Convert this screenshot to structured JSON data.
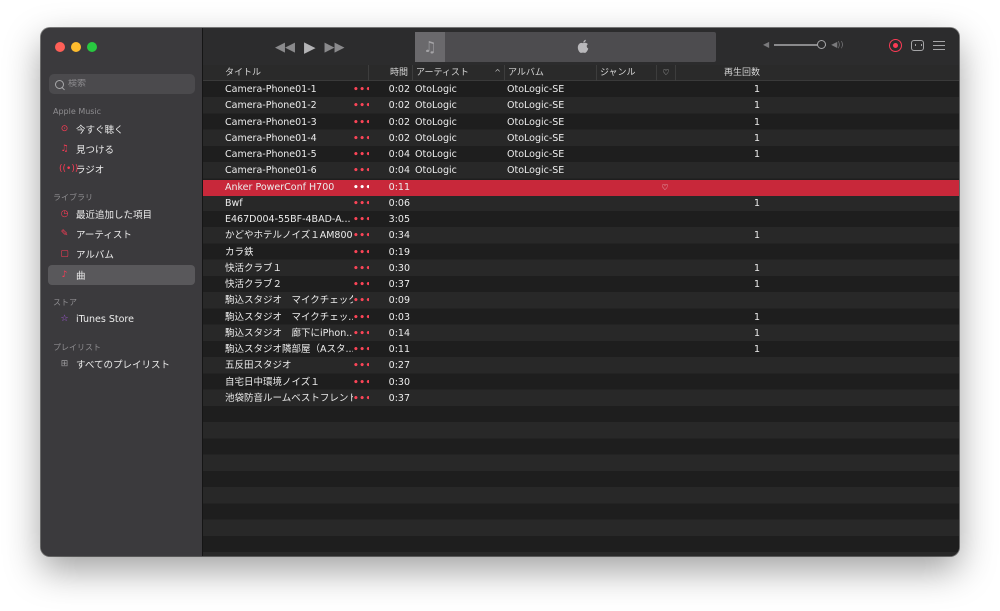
{
  "window": {
    "traffic": [
      "close",
      "minimize",
      "zoom"
    ]
  },
  "sidebar": {
    "search_placeholder": "検索",
    "sections": [
      {
        "title": "Apple Music",
        "items": [
          {
            "label": "今すぐ聴く",
            "icon": "play-circle-icon"
          },
          {
            "label": "見つける",
            "icon": "music-note-icon"
          },
          {
            "label": "ラジオ",
            "icon": "radio-icon"
          }
        ]
      },
      {
        "title": "ライブラリ",
        "items": [
          {
            "label": "最近追加した項目",
            "icon": "clock-icon"
          },
          {
            "label": "アーティスト",
            "icon": "microphone-icon"
          },
          {
            "label": "アルバム",
            "icon": "album-icon"
          },
          {
            "label": "曲",
            "icon": "music-note-icon",
            "selected": true
          }
        ]
      },
      {
        "title": "ストア",
        "items": [
          {
            "label": "iTunes Store",
            "icon": "star-icon"
          }
        ]
      },
      {
        "title": "プレイリスト",
        "items": [
          {
            "label": "すべてのプレイリスト",
            "icon": "grid-icon"
          }
        ]
      }
    ]
  },
  "toolbar": {
    "volume": 1.0
  },
  "table": {
    "columns": {
      "title": "タイトル",
      "time": "時間",
      "artist": "アーティスト",
      "sort_indicator": "^",
      "album": "アルバム",
      "genre": "ジャンル",
      "heart": "♡",
      "plays": "再生回数"
    },
    "more_glyph": "•••",
    "rows": [
      {
        "title": "Camera-Phone01-1",
        "time": "0:02",
        "artist": "OtoLogic",
        "album": "OtoLogic-SE",
        "heart": "",
        "plays": "1"
      },
      {
        "title": "Camera-Phone01-2",
        "time": "0:02",
        "artist": "OtoLogic",
        "album": "OtoLogic-SE",
        "heart": "",
        "plays": "1"
      },
      {
        "title": "Camera-Phone01-3",
        "time": "0:02",
        "artist": "OtoLogic",
        "album": "OtoLogic-SE",
        "heart": "",
        "plays": "1"
      },
      {
        "title": "Camera-Phone01-4",
        "time": "0:02",
        "artist": "OtoLogic",
        "album": "OtoLogic-SE",
        "heart": "",
        "plays": "1"
      },
      {
        "title": "Camera-Phone01-5",
        "time": "0:04",
        "artist": "OtoLogic",
        "album": "OtoLogic-SE",
        "heart": "",
        "plays": "1"
      },
      {
        "title": "Camera-Phone01-6",
        "time": "0:04",
        "artist": "OtoLogic",
        "album": "OtoLogic-SE",
        "heart": "",
        "plays": ""
      },
      {
        "title": "Anker PowerConf H700",
        "time": "0:11",
        "artist": "",
        "album": "",
        "heart": "♡",
        "plays": "",
        "selected": true
      },
      {
        "title": "Bwf",
        "time": "0:06",
        "artist": "",
        "album": "",
        "heart": "",
        "plays": "1"
      },
      {
        "title": "E467D004-55BF-4BAD-A...",
        "time": "3:05",
        "artist": "",
        "album": "",
        "heart": "",
        "plays": ""
      },
      {
        "title": "かどやホテルノイズ１AM800",
        "time": "0:34",
        "artist": "",
        "album": "",
        "heart": "",
        "plays": "1"
      },
      {
        "title": "カラ鉄",
        "time": "0:19",
        "artist": "",
        "album": "",
        "heart": "",
        "plays": ""
      },
      {
        "title": "快活クラブ１",
        "time": "0:30",
        "artist": "",
        "album": "",
        "heart": "",
        "plays": "1"
      },
      {
        "title": "快活クラブ２",
        "time": "0:37",
        "artist": "",
        "album": "",
        "heart": "",
        "plays": "1"
      },
      {
        "title": "駒込スタジオ　マイクチェック",
        "time": "0:09",
        "artist": "",
        "album": "",
        "heart": "",
        "plays": ""
      },
      {
        "title": "駒込スタジオ　マイクチェッ...",
        "time": "0:03",
        "artist": "",
        "album": "",
        "heart": "",
        "plays": "1"
      },
      {
        "title": "駒込スタジオ　廊下にiPhon...",
        "time": "0:14",
        "artist": "",
        "album": "",
        "heart": "",
        "plays": "1"
      },
      {
        "title": "駒込スタジオ隣部屋（Aスタ...",
        "time": "0:11",
        "artist": "",
        "album": "",
        "heart": "",
        "plays": "1"
      },
      {
        "title": "五反田スタジオ",
        "time": "0:27",
        "artist": "",
        "album": "",
        "heart": "",
        "plays": ""
      },
      {
        "title": "自宅日中環境ノイズ１",
        "time": "0:30",
        "artist": "",
        "album": "",
        "heart": "",
        "plays": ""
      },
      {
        "title": "池袋防音ルームベストフレンド",
        "time": "0:37",
        "artist": "",
        "album": "",
        "heart": "",
        "plays": ""
      }
    ]
  },
  "colors": {
    "accent": "#fb3b55",
    "selection": "#c8283a",
    "sidebar_bg": "#3b3a3d",
    "table_bg": "#1e1e1e",
    "table_alt": "#282828"
  }
}
